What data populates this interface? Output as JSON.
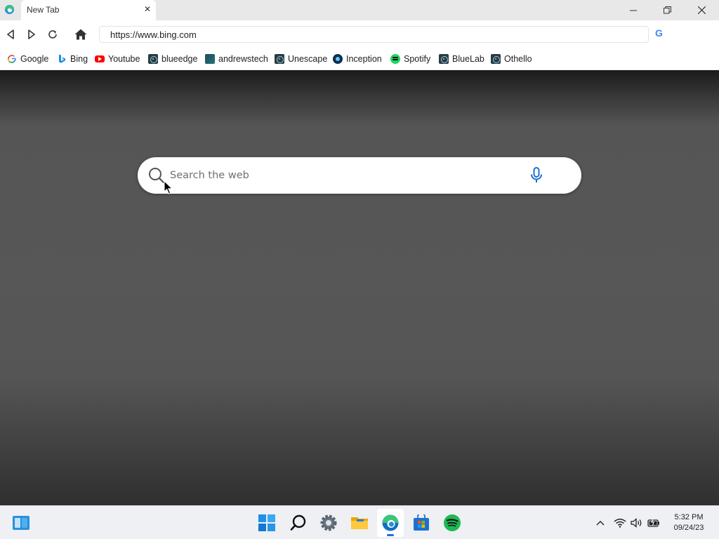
{
  "browser": {
    "tab": {
      "title": "New Tab",
      "close": "✕"
    },
    "address_bar": {
      "url": "https://www.bing.com"
    },
    "search_engine_letter": "G"
  },
  "bookmarks": [
    {
      "label": "Google",
      "icon": "google-icon"
    },
    {
      "label": "Bing",
      "icon": "bing-icon"
    },
    {
      "label": "Youtube",
      "icon": "youtube-icon"
    },
    {
      "label": "blueedge",
      "icon": "react-icon"
    },
    {
      "label": "andrewstech",
      "icon": "andrewstech-icon"
    },
    {
      "label": "Unescape",
      "icon": "react-icon"
    },
    {
      "label": "Inception",
      "icon": "inception-icon"
    },
    {
      "label": "Spotify",
      "icon": "spotify-icon"
    },
    {
      "label": "BlueLab",
      "icon": "react-icon"
    },
    {
      "label": "Othello",
      "icon": "react-icon"
    }
  ],
  "search": {
    "placeholder": "Search the web"
  },
  "taskbar": {
    "apps": [
      "widgets",
      "start",
      "search",
      "settings",
      "file-explorer",
      "edge",
      "store",
      "spotify"
    ],
    "active_app": "edge"
  },
  "clock": {
    "time": "5:32 PM",
    "date": "09/24/23"
  },
  "colors": {
    "accent": "#1f6fd1",
    "titlebar": "#e8e8e8",
    "content_bg": "#555555"
  }
}
